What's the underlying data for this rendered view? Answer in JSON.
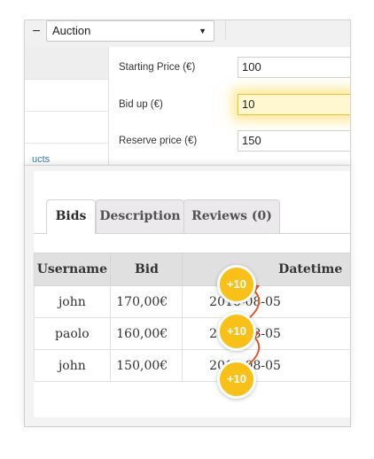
{
  "admin": {
    "auction_type": "Auction",
    "fields": [
      {
        "label": "Starting Price (€)",
        "value": "100"
      },
      {
        "label": "Bid up (€)",
        "value": "10"
      },
      {
        "label": "Reserve price (€)",
        "value": "150"
      }
    ],
    "side_link": "ucts"
  },
  "tabs": [
    {
      "label": "Bids"
    },
    {
      "label": "Description"
    },
    {
      "label": "Reviews (0)"
    }
  ],
  "table": {
    "headers": [
      "Username",
      "Bid",
      "Datetime"
    ],
    "rows": [
      {
        "username": "john",
        "bid": "170,00€",
        "datetime": "2016-08-05"
      },
      {
        "username": "paolo",
        "bid": "160,00€",
        "datetime": "2016-08-05"
      },
      {
        "username": "john",
        "bid": "150,00€",
        "datetime": "2016-08-05"
      }
    ]
  },
  "badges": [
    "+10",
    "+10",
    "+10"
  ],
  "colors": {
    "badge": "#f8c019",
    "arrow": "#e0582a",
    "highlight": "#fff7d0"
  }
}
